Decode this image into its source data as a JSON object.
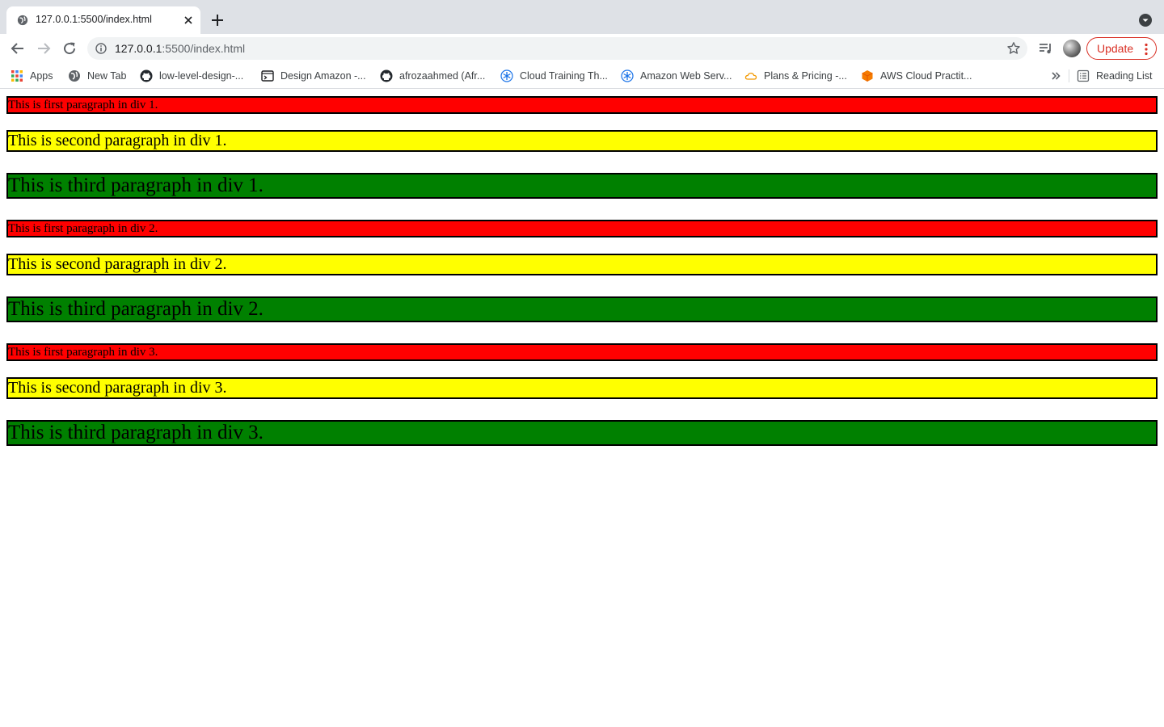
{
  "browser": {
    "tab": {
      "title": "127.0.0.1:5500/index.html"
    },
    "address_bar": {
      "host": "127.0.0.1",
      "rest": ":5500/index.html"
    },
    "update_button": {
      "label": "Update",
      "color": "#d93025"
    },
    "bookmarks": [
      {
        "label": "Apps",
        "icon": "apps-grid-icon"
      },
      {
        "label": "New Tab",
        "icon": "globe-icon"
      },
      {
        "label": "low-level-design-...",
        "icon": "github-icon"
      },
      {
        "label": "Design Amazon -...",
        "icon": "terminal-icon"
      },
      {
        "label": "afrozaahmed (Afr...",
        "icon": "github-icon"
      },
      {
        "label": "Cloud Training Th...",
        "icon": "snowflake-icon"
      },
      {
        "label": "Amazon Web Serv...",
        "icon": "snowflake-icon"
      },
      {
        "label": "Plans & Pricing -...",
        "icon": "cloud-icon"
      },
      {
        "label": "AWS Cloud Practit...",
        "icon": "cube-icon"
      }
    ],
    "reading_list": {
      "label": "Reading List",
      "icon": "reading-list-icon"
    }
  },
  "page": {
    "divs": [
      {
        "paragraphs": [
          "This is first paragraph in div 1.",
          "This is second paragraph in div 1.",
          "This is third paragraph in div 1."
        ]
      },
      {
        "paragraphs": [
          "This is first paragraph in div 2.",
          "This is second paragraph in div 2.",
          "This is third paragraph in div 2."
        ]
      },
      {
        "paragraphs": [
          "This is first paragraph in div 3.",
          "This is second paragraph in div 3.",
          "This is third paragraph in div 3."
        ]
      }
    ],
    "colors": {
      "first": "#ff0000",
      "second": "#ffff00",
      "third": "#008000",
      "border": "#000000"
    }
  }
}
